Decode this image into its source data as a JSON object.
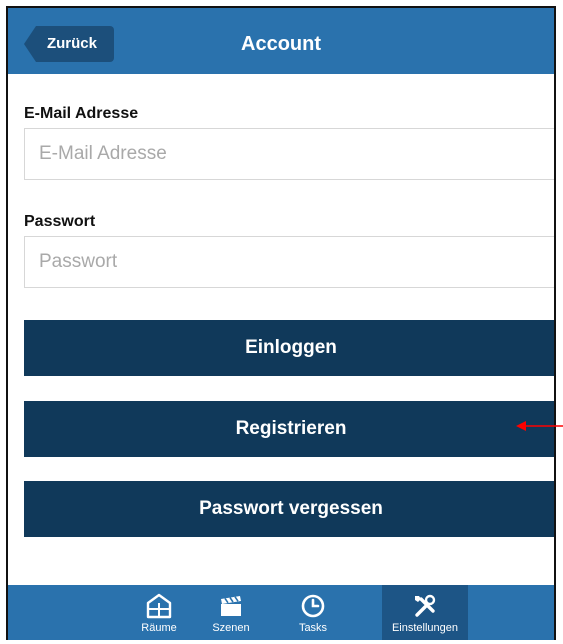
{
  "header": {
    "back_label": "Zurück",
    "title": "Account"
  },
  "form": {
    "email_label": "E-Mail Adresse",
    "email_placeholder": "E-Mail Adresse",
    "email_value": "",
    "password_label": "Passwort",
    "password_placeholder": "Passwort",
    "password_value": ""
  },
  "buttons": {
    "login": "Einloggen",
    "register": "Registrieren",
    "forgot": "Passwort vergessen"
  },
  "tabs": [
    {
      "label": "Räume",
      "icon": "rooms-icon"
    },
    {
      "label": "Szenen",
      "icon": "clapperboard-icon"
    },
    {
      "label": "Tasks",
      "icon": "clock-icon"
    },
    {
      "label": "Einstellungen",
      "icon": "tools-icon",
      "active": true
    }
  ],
  "colors": {
    "header": "#2a72ad",
    "button": "#10395a",
    "annotation_arrow": "#ff0000"
  }
}
